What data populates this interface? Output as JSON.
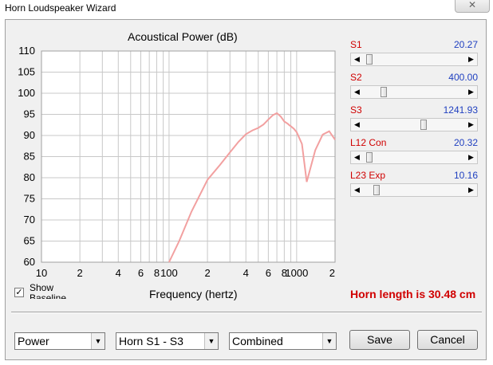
{
  "window": {
    "title": "Horn Loudspeaker Wizard",
    "close_glyph": "✕"
  },
  "chart_data": {
    "type": "line",
    "title": "Acoustical Power (dB)",
    "xlabel": "Frequency (hertz)",
    "ylabel": "",
    "x_scale": "log",
    "xlim": [
      10,
      2000
    ],
    "ylim": [
      60,
      110
    ],
    "yticks": [
      "110",
      "105",
      "100",
      "95",
      "90",
      "85",
      "80",
      "75",
      "70",
      "65",
      "60"
    ],
    "xtick_labels": [
      {
        "label": "10",
        "value": 10
      },
      {
        "label": "2",
        "value": 20
      },
      {
        "label": "4",
        "value": 40
      },
      {
        "label": "6",
        "value": 60
      },
      {
        "label": "8",
        "value": 80
      },
      {
        "label": "100",
        "value": 100
      },
      {
        "label": "2",
        "value": 200
      },
      {
        "label": "4",
        "value": 400
      },
      {
        "label": "6",
        "value": 600
      },
      {
        "label": "8",
        "value": 800
      },
      {
        "label": "1000",
        "value": 1000
      },
      {
        "label": "2",
        "value": 2000
      }
    ],
    "grid": true,
    "series": [
      {
        "color": "#f2a0a0",
        "x": [
          100,
          120,
          150,
          200,
          250,
          300,
          350,
          400,
          450,
          500,
          550,
          600,
          650,
          700,
          750,
          800,
          850,
          880,
          900,
          950,
          1000,
          1100,
          1200,
          1400,
          1600,
          1800,
          2000
        ],
        "y": [
          60,
          65,
          72,
          79.5,
          83,
          86,
          88.5,
          90.3,
          91.2,
          91.8,
          92.6,
          93.8,
          94.8,
          95.3,
          94.5,
          93.3,
          92.8,
          92.4,
          92.2,
          91.6,
          90.8,
          88,
          79,
          86.5,
          90.2,
          91,
          89
        ]
      }
    ]
  },
  "sliders": [
    {
      "label": "S1",
      "value": "20.27",
      "fraction": 0.03
    },
    {
      "label": "S2",
      "value": "400.00",
      "fraction": 0.18
    },
    {
      "label": "S3",
      "value": "1241.93",
      "fraction": 0.59
    },
    {
      "label": "L12 Con",
      "value": "20.32",
      "fraction": 0.03
    },
    {
      "label": "L23 Exp",
      "value": "10.16",
      "fraction": 0.11
    }
  ],
  "scroll_arrows": {
    "left": "◀",
    "right": "▶"
  },
  "baseline": {
    "label": "Show Baseline",
    "checked_glyph": "✓"
  },
  "horn_length_text": "Horn length is 30.48 cm",
  "combos": [
    {
      "value": "Power"
    },
    {
      "value": "Horn S1 - S3"
    },
    {
      "value": "Combined"
    }
  ],
  "combo_arrow": "▼",
  "buttons": {
    "save": "Save",
    "cancel": "Cancel"
  }
}
